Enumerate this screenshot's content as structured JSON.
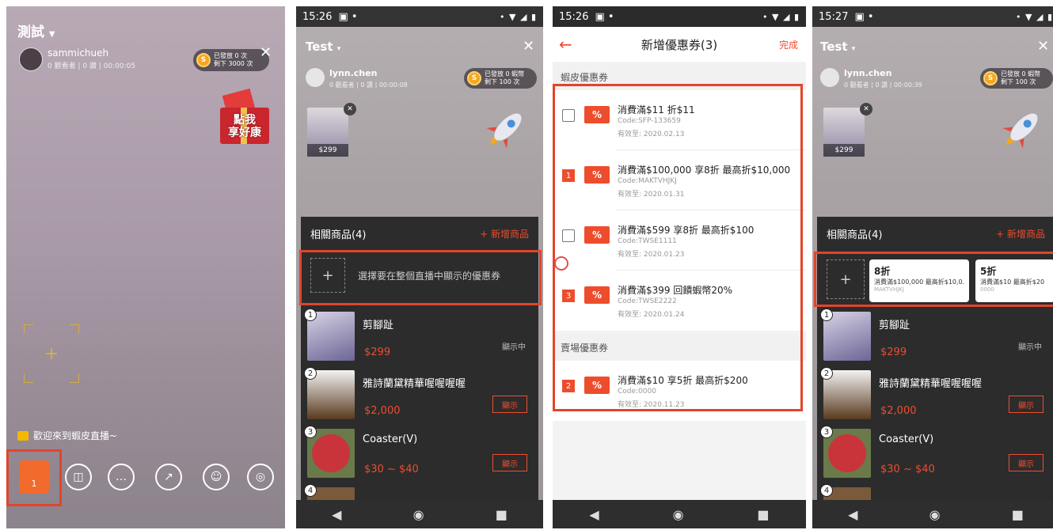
{
  "panel1": {
    "title": "測試",
    "username": "sammichueh",
    "stats": "0 觀看者 | 0 讚 | 00:00:05",
    "coin_line1": "已發放 0 次",
    "coin_line2": "剩下 3000 次",
    "promo_line1": "點我",
    "promo_line2": "享好康",
    "welcome": "歡迎來到蝦皮直播~",
    "cart_count": "1"
  },
  "panel2": {
    "time": "15:26",
    "title": "Test",
    "username": "lynn.chen",
    "stats": "0 觀看者 | 0 讚 | 00:00:08",
    "coin_line1": "已發放 0 蝦幣",
    "coin_line2": "剩下 100 次",
    "pinned_price": "$299",
    "sheet_title": "相關商品(4)",
    "add_product": "+ 新增商品",
    "voucher_prompt": "選擇要在整個直播中顯示的優惠券",
    "products": [
      {
        "num": "1",
        "name": "剪腳趾",
        "price": "$299",
        "state": "顯示中"
      },
      {
        "num": "2",
        "name": "雅詩蘭黛精華喔喔喔喔",
        "price": "$2,000",
        "state": "顯示"
      },
      {
        "num": "3",
        "name": "Coaster(V)",
        "price": "$30 ~ $40",
        "state": "顯示"
      },
      {
        "num": "4",
        "name": "",
        "price": "",
        "state": ""
      }
    ]
  },
  "panel3": {
    "time": "15:26",
    "header_title": "新增優惠券(3)",
    "done": "完成",
    "section_shopee": "蝦皮優惠券",
    "section_shop": "賣場優惠券",
    "tag": "%",
    "coupons": [
      {
        "mark": "",
        "title": "消費滿$11 折$11",
        "code": "Code:SFP-133659",
        "expiry": "有效至: 2020.02.13"
      },
      {
        "mark": "1",
        "title": "消費滿$100,000 享8折 最高折$10,000",
        "code": "Code:MAKTVHJKJ",
        "expiry": "有效至: 2020.01.31"
      },
      {
        "mark": "",
        "title": "消費滿$599 享8折 最高折$100",
        "code": "Code:TWSE1111",
        "expiry": "有效至: 2020.01.23"
      },
      {
        "mark": "3",
        "title": "消費滿$399 回饋蝦幣20%",
        "code": "Code:TWSE2222",
        "expiry": "有效至: 2020.01.24"
      }
    ],
    "shop_coupon": {
      "mark": "2",
      "title": "消費滿$10 享5折 最高折$200",
      "code": "Code:0000",
      "expiry": "有效至: 2020.11.23"
    }
  },
  "panel4": {
    "time": "15:27",
    "title": "Test",
    "username": "lynn.chen",
    "stats": "0 觀看者 | 0 讚 | 00:00:39",
    "coin_line1": "已發放 0 蝦幣",
    "coin_line2": "剩下 100 次",
    "pinned_price": "$299",
    "sheet_title": "相關商品(4)",
    "add_product": "+ 新增商品",
    "vouchers": [
      {
        "big": "8折",
        "desc": "消費滿$100,000 最高折$10,0...",
        "code": "MAKTVHJKJ"
      },
      {
        "big": "5折",
        "desc": "消費滿$10 最高折$20",
        "code": "0000"
      }
    ],
    "products": [
      {
        "num": "1",
        "name": "剪腳趾",
        "price": "$299",
        "state": "顯示中"
      },
      {
        "num": "2",
        "name": "雅詩蘭黛精華喔喔喔喔",
        "price": "$2,000",
        "state": "顯示"
      },
      {
        "num": "3",
        "name": "Coaster(V)",
        "price": "$30 ~ $40",
        "state": "顯示"
      },
      {
        "num": "4",
        "name": "",
        "price": "",
        "state": ""
      }
    ]
  }
}
